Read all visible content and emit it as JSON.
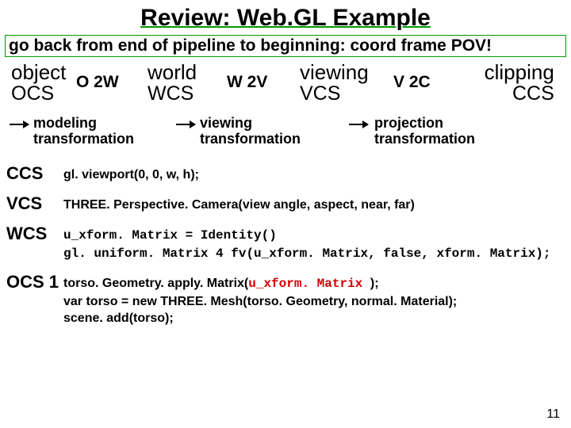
{
  "title": "Review: Web.GL Example",
  "subtitle": "go back from end of pipeline to beginning: coord frame POV!",
  "pipeline": {
    "frames": {
      "object": {
        "big": "object",
        "small": "OCS"
      },
      "world": {
        "big": "world",
        "small": "WCS"
      },
      "viewing": {
        "big": "viewing",
        "small": "VCS"
      },
      "clipping": {
        "big": "clipping",
        "small": "CCS"
      }
    },
    "labels": {
      "o2w": "O 2W",
      "w2v": "W 2V",
      "v2c": "V 2C"
    },
    "xforms": {
      "modeling": "modeling\ntransformation",
      "viewing": "viewing\ntransformation",
      "projection": "projection\ntransformation"
    }
  },
  "stages": {
    "ccs": {
      "tag": "CCS",
      "body": "gl. viewport(0, 0, w, h);"
    },
    "vcs": {
      "tag": "VCS",
      "body": "THREE. Perspective. Camera(view angle, aspect, near, far)"
    },
    "wcs": {
      "tag": "WCS",
      "line1": "u_xform. Matrix = Identity()",
      "line2": "gl. uniform. Matrix 4 fv(u_xform. Matrix, false, xform. Matrix);"
    },
    "ocs1": {
      "tag": "OCS 1",
      "line1a": "torso. Geometry. apply. Matrix(",
      "line1b": "u_xform. Matrix ",
      "line1c": ");",
      "line2": "var torso = new THREE. Mesh(torso. Geometry, normal. Material);",
      "line3": "scene. add(torso);"
    }
  },
  "pagenum": "11"
}
